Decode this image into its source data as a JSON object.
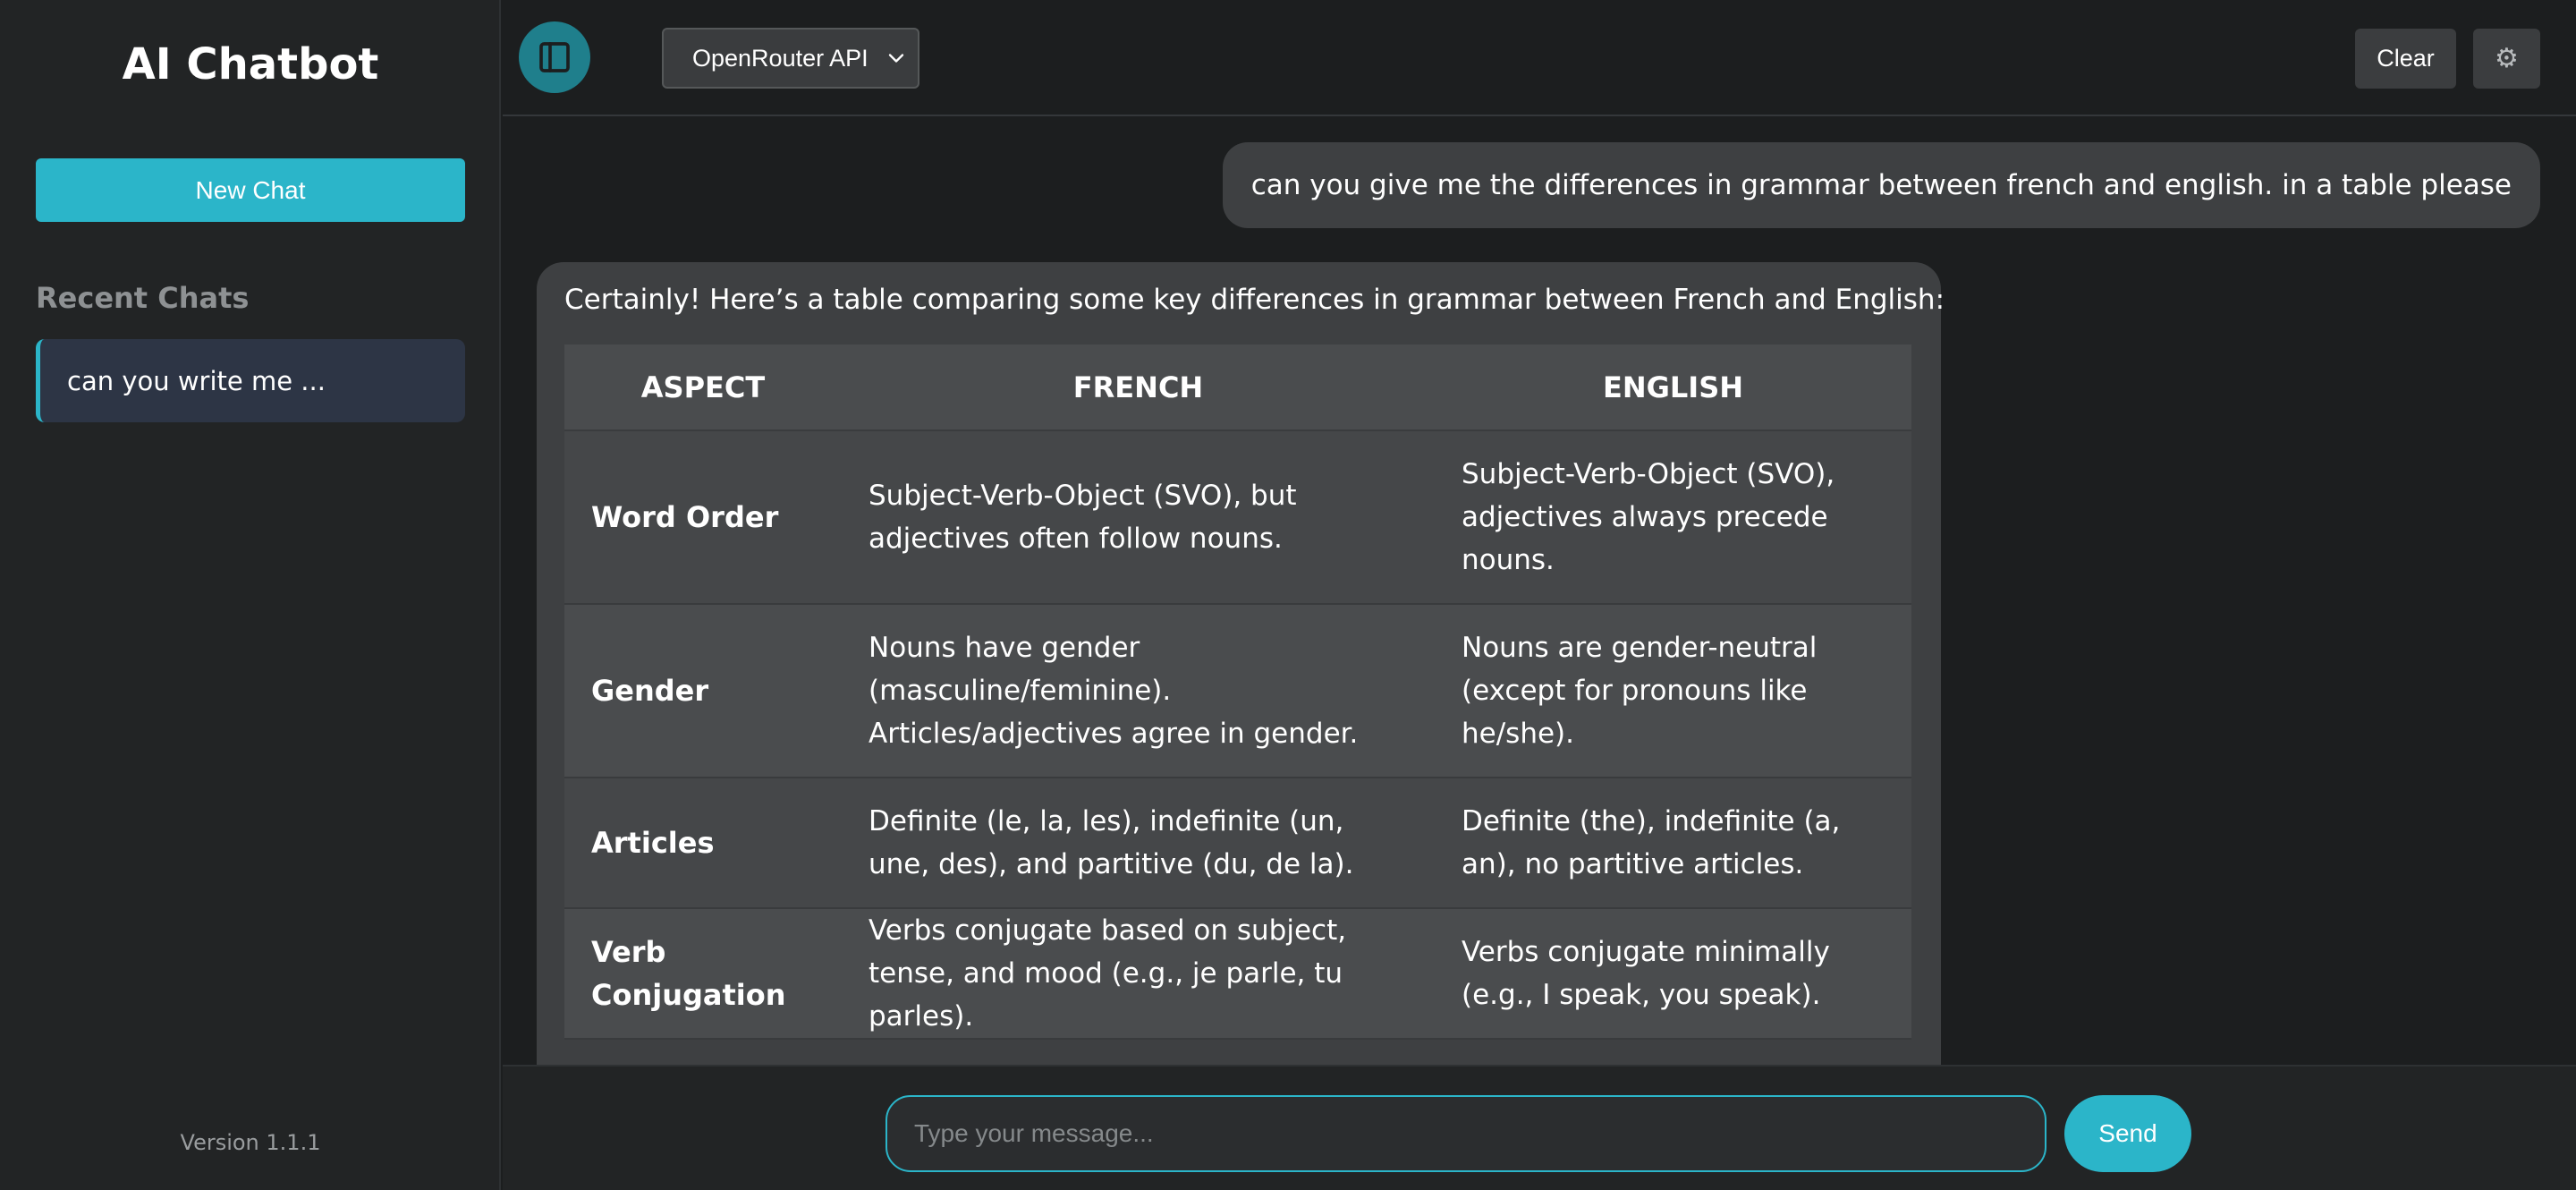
{
  "sidebar": {
    "title": "AI Chatbot",
    "new_chat_label": "New Chat",
    "recent_heading": "Recent Chats",
    "recent_items": [
      {
        "label": "can you write me ..."
      }
    ],
    "version": "Version 1.1.1"
  },
  "header": {
    "api_select": {
      "selected": "OpenRouter API"
    },
    "clear_label": "Clear",
    "toggle_icon": "sidebar-toggle-icon",
    "settings_icon": "gear-icon"
  },
  "messages": {
    "user": "can you give me the differences in grammar between french and english. in a table please",
    "bot_intro": "Certainly! Here’s a table comparing some key differences in grammar between French and English:",
    "table": {
      "headers": [
        "ASPECT",
        "FRENCH",
        "ENGLISH"
      ],
      "rows": [
        {
          "aspect": "Word Order",
          "french": "Subject-Verb-Object (SVO), but adjectives often follow nouns.",
          "english": "Subject-Verb-Object (SVO), adjectives always precede nouns."
        },
        {
          "aspect": "Gender",
          "french": "Nouns have gender (masculine/feminine). Articles/adjectives agree in gender.",
          "english": "Nouns are gender-neutral (except for pronouns like he/she)."
        },
        {
          "aspect": "Articles",
          "french": "Definite (le, la, les), indefinite (un, une, des), and partitive (du, de la).",
          "english": "Definite (the), indefinite (a, an), no partitive articles."
        },
        {
          "aspect": "Verb Conjugation",
          "french": "Verbs conjugate based on subject, tense, and mood (e.g., je parle, tu parles).",
          "english": "Verbs conjugate minimally (e.g., I speak, you speak)."
        }
      ]
    }
  },
  "composer": {
    "placeholder": "Type your message...",
    "value": "",
    "send_label": "Send"
  },
  "colors": {
    "accent": "#2bb5c9",
    "background": "#1c1e1f",
    "sidebar": "#222425",
    "bubble": "#3e4042",
    "recent_item_bg": "#2d3545"
  }
}
